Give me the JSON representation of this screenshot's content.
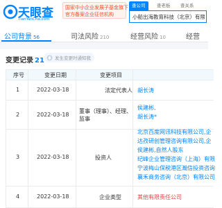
{
  "header": {
    "logo_title": "天眼查",
    "logo_subtitle": "TianYanCha.com",
    "banner_line1": "国家中小企业发展子基金旗下",
    "banner_line2": "官方备案企业征信机构",
    "search_tabs": [
      "查公司",
      "查老板",
      "查关系"
    ],
    "search_value": "小船出海教育科技（北京）有限公司"
  },
  "nav": {
    "tabs": [
      {
        "label": "公司背景",
        "count": "56"
      },
      {
        "label": "司法风险",
        "count": "210"
      },
      {
        "label": "经营风险",
        "count": "10"
      },
      {
        "label": "经营",
        "count": ""
      }
    ]
  },
  "section": {
    "title": "变更记录",
    "count": "21",
    "notify_label": "发生变更时通知我"
  },
  "table": {
    "headers": [
      "序号",
      "变更日期",
      "变更项目"
    ],
    "rows": [
      {
        "index": "1",
        "date": "2022-03-18",
        "item": [
          "法定代表人"
        ],
        "value": [
          "胡长涛"
        ]
      },
      {
        "index": "2",
        "date": "2022-03-18",
        "item": [
          "董事（理事）、经理、",
          "监事"
        ],
        "value": [
          "侯建彬,",
          "胡长涛*"
        ]
      },
      {
        "index": "3",
        "date": "2022-03-18",
        "item": [
          "投资人"
        ],
        "value": [
          "北京百度网讯科技有限公司,企",
          "达孜研创管理咨询有限公司,企",
          "侯建彬,自然人股东",
          "纪峰企业管理咨询（上海）有限",
          "宁波梅山保税港区瀚信投资咨询",
          "襄禾商务咨询（北京）有限公司"
        ]
      },
      {
        "index": "4",
        "date": "2022-03-18",
        "item": [
          "企业类型"
        ],
        "value": [
          "其他有限责任公司"
        ]
      }
    ]
  },
  "colors": {
    "brand": "#0084ff",
    "accent_red": "#e64545"
  }
}
